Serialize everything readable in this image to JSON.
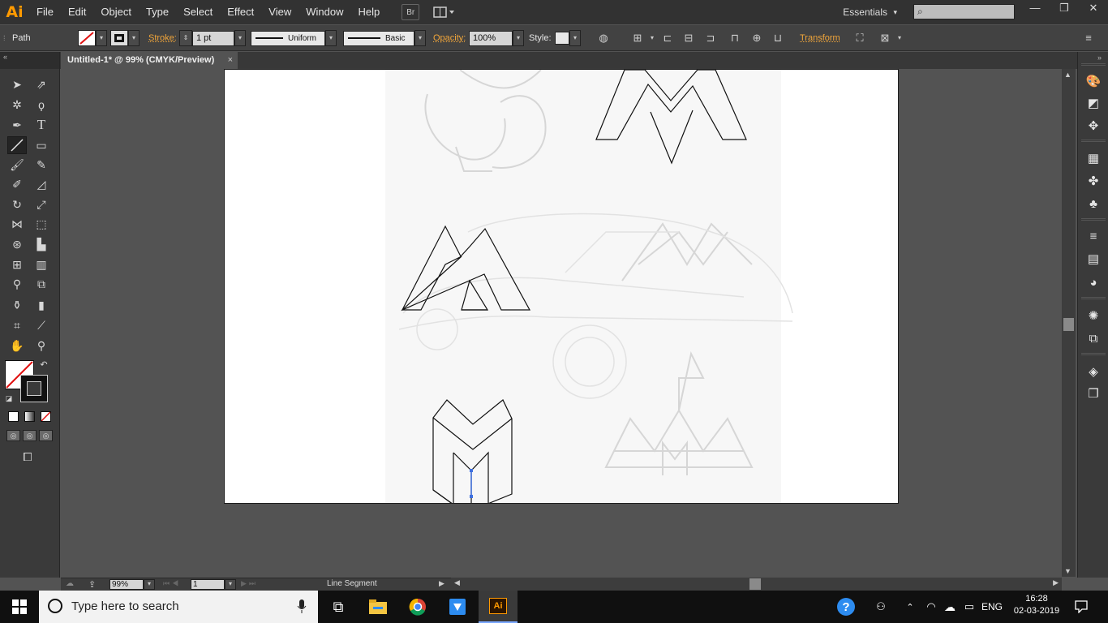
{
  "app": {
    "logo": "Ai",
    "accent": "#ff9a00"
  },
  "menu": [
    "File",
    "Edit",
    "Object",
    "Type",
    "Select",
    "Effect",
    "View",
    "Window",
    "Help"
  ],
  "menubar_buttons": {
    "bridge": "Br"
  },
  "workspace": {
    "label": "Essentials"
  },
  "window_controls": {
    "minimize": "—",
    "restore": "❐",
    "close": "✕"
  },
  "control": {
    "selection_type": "Path",
    "stroke_label": "Stroke:",
    "stroke_weight": "1 pt",
    "profile": "Uniform",
    "brush": "Basic",
    "opacity_label": "Opacity:",
    "opacity": "100%",
    "style_label": "Style:",
    "transform": "Transform"
  },
  "document": {
    "tab_title": "Untitled-1* @ 99% (CMYK/Preview)",
    "close": "×"
  },
  "status": {
    "zoom": "99%",
    "artboard": "1",
    "tool": "Line Segment"
  },
  "taskbar": {
    "search_placeholder": "Type here to search",
    "language": "ENG",
    "time": "16:28",
    "date": "02-03-2019"
  }
}
